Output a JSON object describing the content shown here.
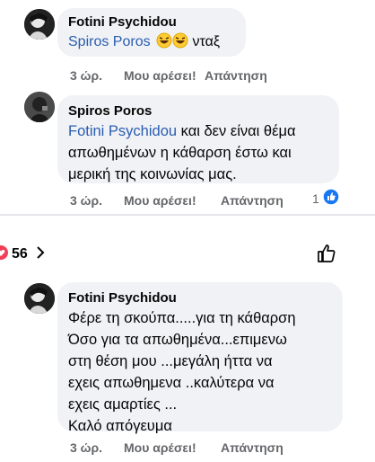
{
  "comment1": {
    "author": "Fotini Psychidou",
    "mention": "Spiros Poros",
    "text": "νταξ",
    "time": "3 ώρ.",
    "like": "Μου αρέσει!",
    "reply": "Απάντηση",
    "emoji_icon": "laughing-tears-emoji"
  },
  "comment2": {
    "author": "Spiros Poros",
    "mention": "Fotini Psychidou",
    "text_line1": "και δεν είναι θέμα",
    "text_line2": "απωθημένων η κάθαρση έστω και",
    "text_line3": "μερική της κοινωνίας μας.",
    "time": "3 ώρ.",
    "like": "Μου αρέσει!",
    "reply": "Απάντηση",
    "reaction_count": "1",
    "reaction_icon": "like-reaction-icon"
  },
  "toolbar": {
    "like_count": "56",
    "icons": [
      "heart-reaction-icon",
      "chevron-right-icon",
      "thumbs-up-icon"
    ]
  },
  "comment3": {
    "author": "Fotini Psychidou",
    "lines": [
      "Φέρε τη σκούπα.....για τη κάθαρση",
      "Όσο για τα απωθημένα...επιμενω",
      "στη θέση μου ...μεγάλη ήττα να",
      "εχεις απωθημενα ..καλύτερα να",
      "εχεις αμαρτίες ...",
      "Καλό απόγευμα"
    ],
    "time": "3 ώρ.",
    "like": "Μου αρέσει!",
    "reply": "Απάντηση"
  },
  "colors": {
    "bubble": "#f0f2f5",
    "mention": "#2a5db0",
    "meta": "#65676b",
    "like_blue": "#1877f2",
    "heart_red": "#f33e58"
  }
}
